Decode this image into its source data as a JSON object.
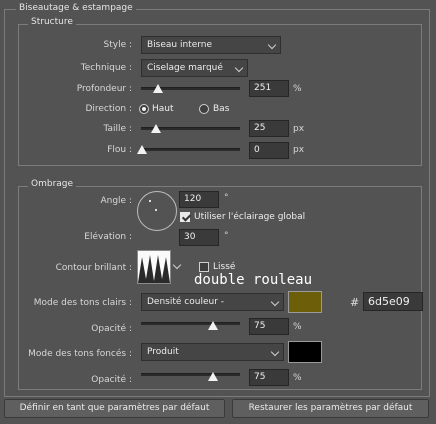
{
  "title": "Biseautage & estampage",
  "structure": {
    "legend": "Structure",
    "style": {
      "label": "Style :",
      "value": "Biseau interne"
    },
    "technique": {
      "label": "Technique :",
      "value": "Ciselage marqué"
    },
    "depth": {
      "label": "Profondeur :",
      "value": "251",
      "unit": "%"
    },
    "direction": {
      "label": "Direction :",
      "up": "Haut",
      "down": "Bas"
    },
    "size": {
      "label": "Taille :",
      "value": "25",
      "unit": "px"
    },
    "soften": {
      "label": "Flou :",
      "value": "0",
      "unit": "px"
    }
  },
  "shading": {
    "legend": "Ombrage",
    "angle": {
      "label": "Angle :",
      "value": "120",
      "unit": "°"
    },
    "global_light": {
      "label": "Utiliser l'éclairage global",
      "checked": true
    },
    "altitude": {
      "label": "Elévation :",
      "value": "30",
      "unit": "°"
    },
    "gloss": {
      "label": "Contour brillant :",
      "antialias": "Lissé",
      "note": "double rouleau"
    },
    "highlight_mode": {
      "label": "Mode des tons clairs :",
      "value": "Densité couleur -",
      "color": "#6d5e09",
      "hash": "#",
      "hex": "6d5e09"
    },
    "highlight_opacity": {
      "label": "Opacité :",
      "value": "75",
      "unit": "%"
    },
    "shadow_mode": {
      "label": "Mode des tons foncés :",
      "value": "Produit",
      "color": "#000000"
    },
    "shadow_opacity": {
      "label": "Opacité :",
      "value": "75",
      "unit": "%"
    }
  },
  "buttons": {
    "make_default": "Définir en tant que paramètres par défaut",
    "reset_default": "Restaurer les paramètres par défaut"
  }
}
